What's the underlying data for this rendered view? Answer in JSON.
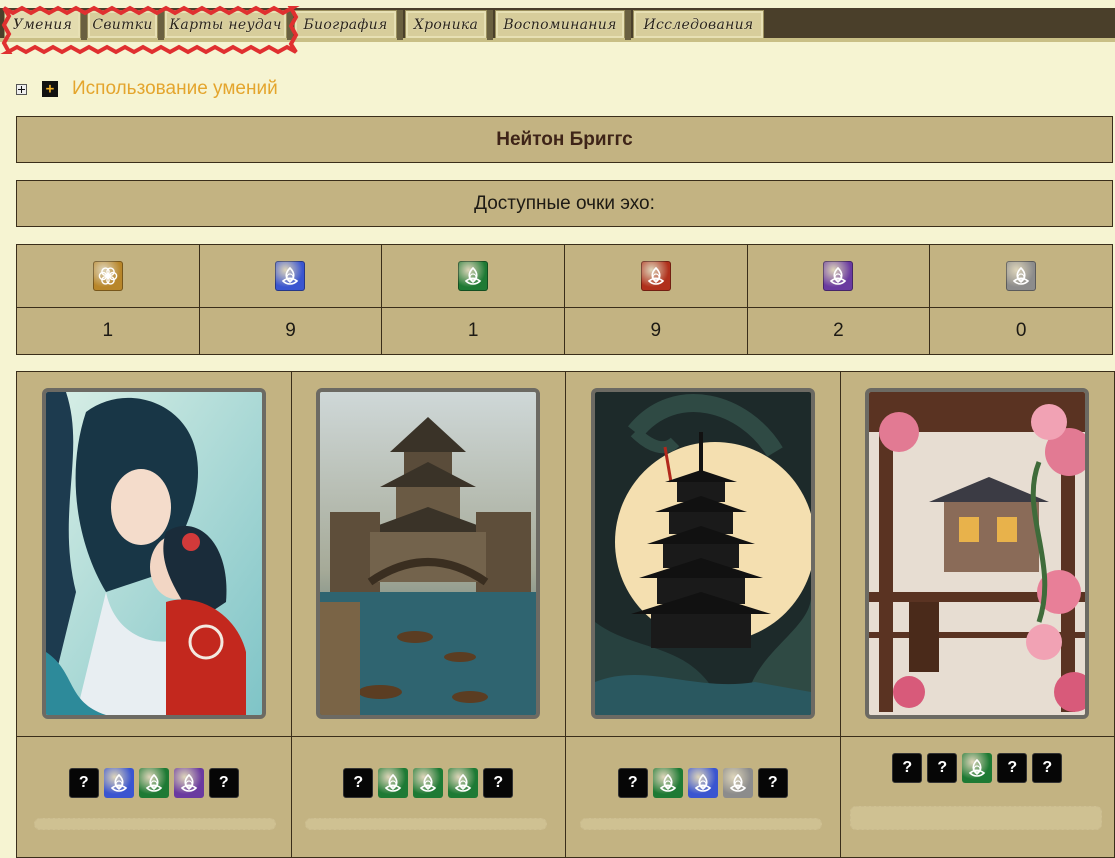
{
  "tabs": [
    {
      "label": "Умения",
      "active": true
    },
    {
      "label": "Свитки"
    },
    {
      "label": "Карты неудач"
    },
    {
      "label": "Биография"
    },
    {
      "label": "Хроника"
    },
    {
      "label": "Воспоминания"
    },
    {
      "label": "Исследования"
    }
  ],
  "accordion": {
    "label": "Использование умений",
    "expand_icon": "plus-square-icon",
    "toggle_icon": "plus-box-icon"
  },
  "character": {
    "name": "Нейтон Бриггс"
  },
  "echo": {
    "title": "Доступные очки эхо:",
    "types": [
      {
        "icon": "gold-flower-echo-icon",
        "color": "#b8862a",
        "value": "1"
      },
      {
        "icon": "blue-triquetra-icon",
        "color": "#3a55d0",
        "value": "9"
      },
      {
        "icon": "green-triquetra-icon",
        "color": "#1e7a34",
        "value": "1"
      },
      {
        "icon": "red-triquetra-icon",
        "color": "#b0301c",
        "value": "9"
      },
      {
        "icon": "purple-triquetra-icon",
        "color": "#6a3aa0",
        "value": "2"
      },
      {
        "icon": "gray-triquetra-icon",
        "color": "#8c8c8c",
        "value": "0"
      }
    ]
  },
  "cards": [
    {
      "art": "elf-couple-card-art",
      "chips": [
        "q",
        "blue",
        "green",
        "purple",
        "q"
      ]
    },
    {
      "art": "canal-town-card-art",
      "chips": [
        "q",
        "green",
        "green",
        "green",
        "q"
      ]
    },
    {
      "art": "serpent-pagoda-card-art",
      "chips": [
        "q",
        "green",
        "blue",
        "gray",
        "q"
      ]
    },
    {
      "art": "flower-veranda-card-art",
      "chips": [
        "q",
        "q",
        "green",
        "q",
        "q"
      ]
    }
  ],
  "chip_colors": {
    "blue": "#3a55d0",
    "green": "#1e7a34",
    "purple": "#6a3aa0",
    "gray": "#8c8c8c"
  },
  "unknown_symbol": "?",
  "highlight_color": "#e03030"
}
